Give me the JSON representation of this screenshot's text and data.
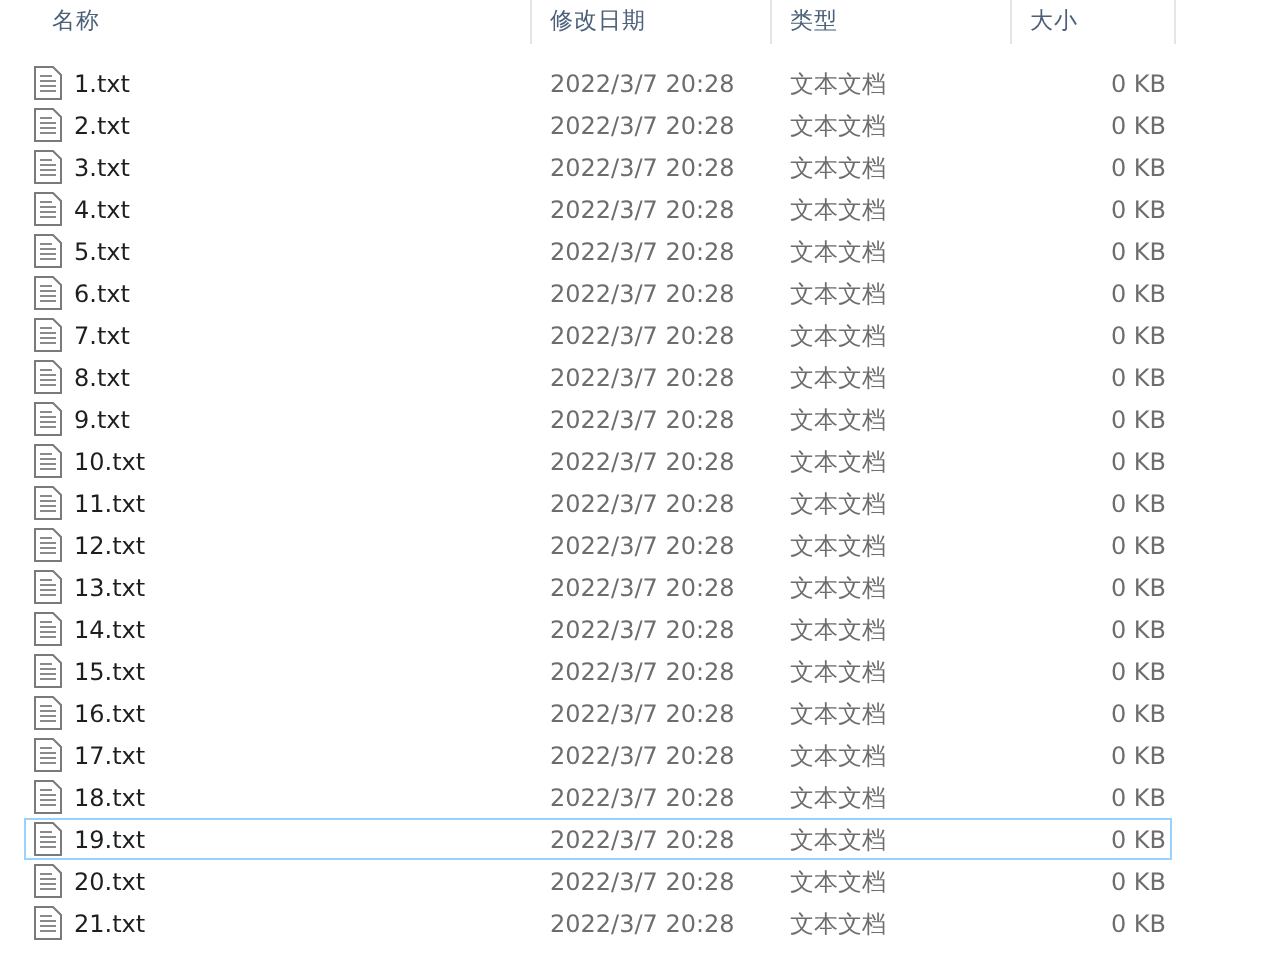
{
  "columns": [
    "名称",
    "修改日期",
    "类型",
    "大小"
  ],
  "rows": [
    {
      "name": "1.txt",
      "modified": "2022/3/7 20:28",
      "type": "文本文档",
      "size": "0 KB",
      "focused": false
    },
    {
      "name": "2.txt",
      "modified": "2022/3/7 20:28",
      "type": "文本文档",
      "size": "0 KB",
      "focused": false
    },
    {
      "name": "3.txt",
      "modified": "2022/3/7 20:28",
      "type": "文本文档",
      "size": "0 KB",
      "focused": false
    },
    {
      "name": "4.txt",
      "modified": "2022/3/7 20:28",
      "type": "文本文档",
      "size": "0 KB",
      "focused": false
    },
    {
      "name": "5.txt",
      "modified": "2022/3/7 20:28",
      "type": "文本文档",
      "size": "0 KB",
      "focused": false
    },
    {
      "name": "6.txt",
      "modified": "2022/3/7 20:28",
      "type": "文本文档",
      "size": "0 KB",
      "focused": false
    },
    {
      "name": "7.txt",
      "modified": "2022/3/7 20:28",
      "type": "文本文档",
      "size": "0 KB",
      "focused": false
    },
    {
      "name": "8.txt",
      "modified": "2022/3/7 20:28",
      "type": "文本文档",
      "size": "0 KB",
      "focused": false
    },
    {
      "name": "9.txt",
      "modified": "2022/3/7 20:28",
      "type": "文本文档",
      "size": "0 KB",
      "focused": false
    },
    {
      "name": "10.txt",
      "modified": "2022/3/7 20:28",
      "type": "文本文档",
      "size": "0 KB",
      "focused": false
    },
    {
      "name": "11.txt",
      "modified": "2022/3/7 20:28",
      "type": "文本文档",
      "size": "0 KB",
      "focused": false
    },
    {
      "name": "12.txt",
      "modified": "2022/3/7 20:28",
      "type": "文本文档",
      "size": "0 KB",
      "focused": false
    },
    {
      "name": "13.txt",
      "modified": "2022/3/7 20:28",
      "type": "文本文档",
      "size": "0 KB",
      "focused": false
    },
    {
      "name": "14.txt",
      "modified": "2022/3/7 20:28",
      "type": "文本文档",
      "size": "0 KB",
      "focused": false
    },
    {
      "name": "15.txt",
      "modified": "2022/3/7 20:28",
      "type": "文本文档",
      "size": "0 KB",
      "focused": false
    },
    {
      "name": "16.txt",
      "modified": "2022/3/7 20:28",
      "type": "文本文档",
      "size": "0 KB",
      "focused": false
    },
    {
      "name": "17.txt",
      "modified": "2022/3/7 20:28",
      "type": "文本文档",
      "size": "0 KB",
      "focused": false
    },
    {
      "name": "18.txt",
      "modified": "2022/3/7 20:28",
      "type": "文本文档",
      "size": "0 KB",
      "focused": false
    },
    {
      "name": "19.txt",
      "modified": "2022/3/7 20:28",
      "type": "文本文档",
      "size": "0 KB",
      "focused": true
    },
    {
      "name": "20.txt",
      "modified": "2022/3/7 20:28",
      "type": "文本文档",
      "size": "0 KB",
      "focused": false
    },
    {
      "name": "21.txt",
      "modified": "2022/3/7 20:28",
      "type": "文本文档",
      "size": "0 KB",
      "focused": false
    }
  ]
}
